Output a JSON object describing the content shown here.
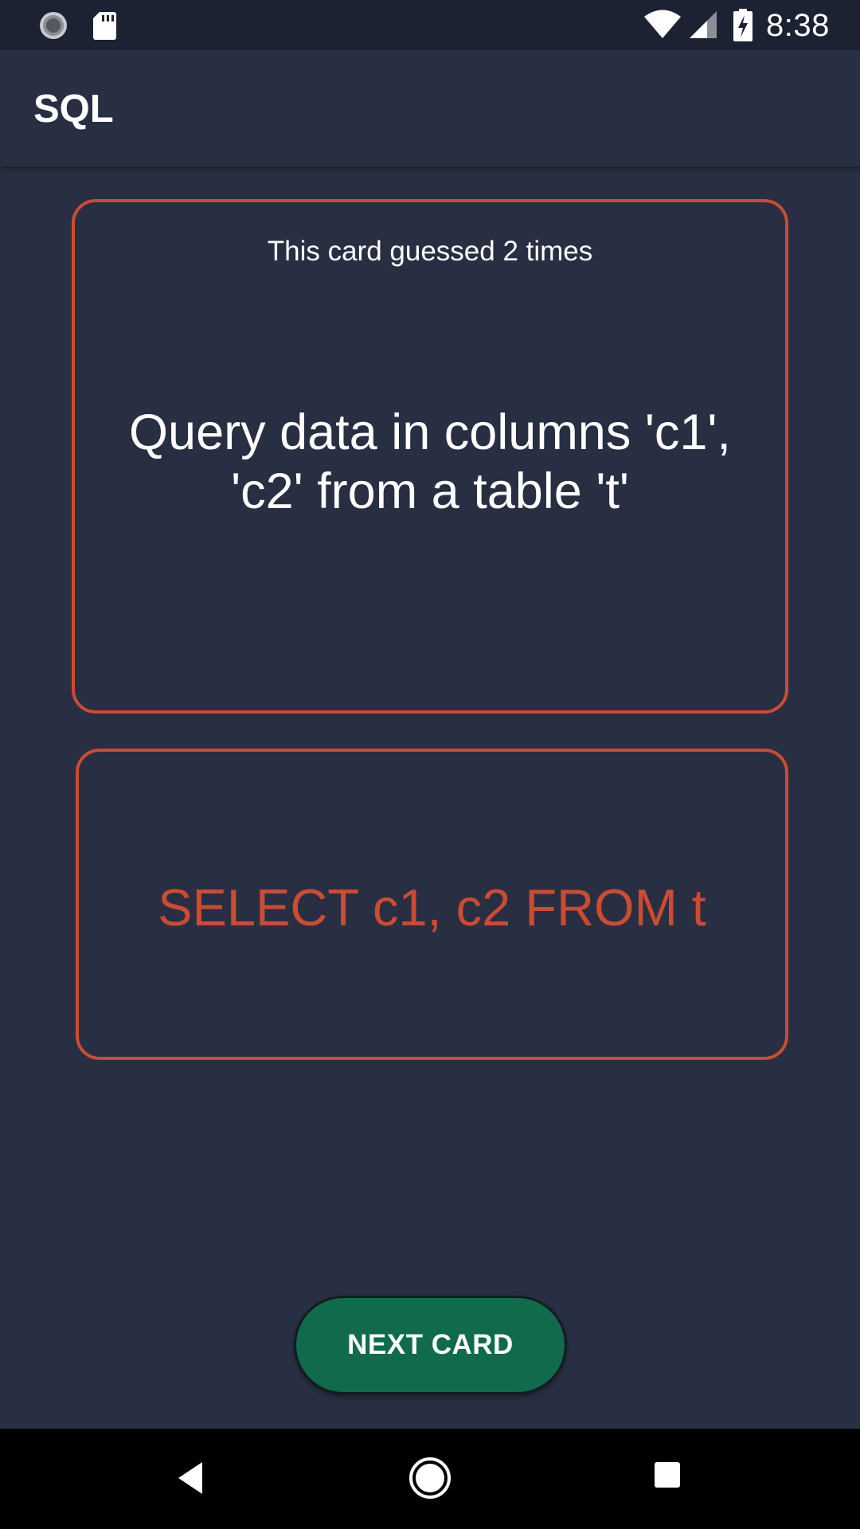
{
  "status_bar": {
    "time": "8:38",
    "icons": [
      "loading-icon",
      "sd-card-icon",
      "wifi-icon",
      "cell-signal-icon",
      "battery-charging-icon"
    ]
  },
  "app_bar": {
    "title": "SQL"
  },
  "question_card": {
    "guess_count_text": "This card guessed 2 times",
    "question": "Query data in columns 'c1', 'c2' from a table 't'"
  },
  "answer_card": {
    "answer": "SELECT c1, c2 FROM t"
  },
  "next_button": {
    "label": "NEXT CARD"
  },
  "nav_bar": {
    "icons": [
      "back-icon",
      "home-icon",
      "recents-icon"
    ]
  },
  "colors": {
    "background": "#282f42",
    "status_bar": "#1c2232",
    "accent": "#cc4b31",
    "button": "#0f6b4b",
    "text": "#ffffff"
  }
}
